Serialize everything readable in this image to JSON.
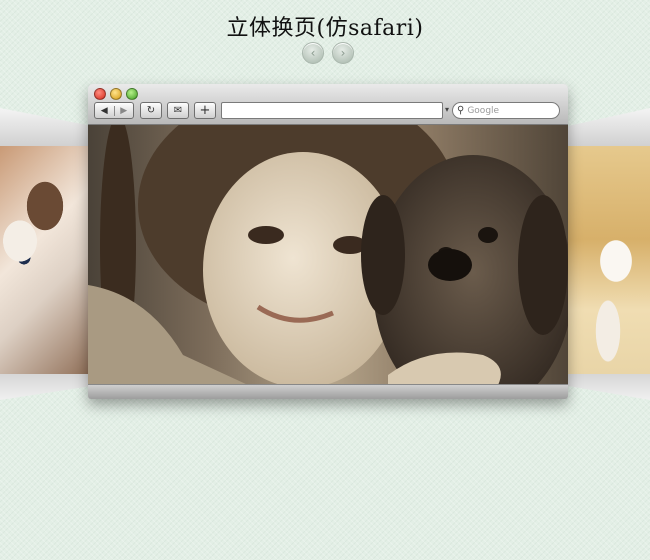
{
  "page": {
    "title": "立体换页(仿safari)",
    "nav_prev_icon": "‹",
    "nav_next_icon": "›"
  },
  "browser": {
    "back_icon": "◀",
    "forward_icon": "▶",
    "reload_icon": "↻",
    "bookmark_icon": "✉",
    "add_icon": "+",
    "address_value": "",
    "search_icon": "⚲",
    "search_placeholder": "Google",
    "traffic_lights": {
      "close": "#d42a1c",
      "minimize": "#d49a12",
      "zoom": "#3f9e20"
    }
  },
  "pages": [
    {
      "position": "left",
      "subject": "cat"
    },
    {
      "position": "center",
      "subject": "girl-with-dog"
    },
    {
      "position": "right",
      "subject": "white-dog"
    }
  ]
}
